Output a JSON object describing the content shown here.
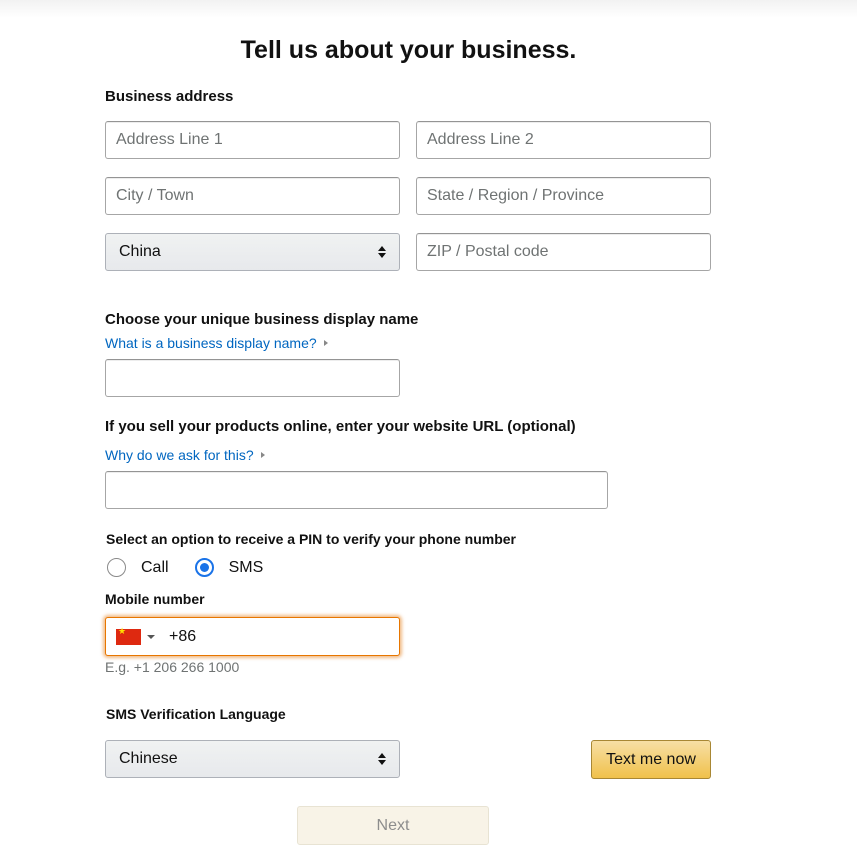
{
  "page": {
    "title": "Tell us about your business."
  },
  "address": {
    "section_label": "Business address",
    "line1_placeholder": "Address Line 1",
    "line2_placeholder": "Address Line 2",
    "city_placeholder": "City / Town",
    "state_placeholder": "State / Region / Province",
    "country_selected": "China",
    "zip_placeholder": "ZIP / Postal code"
  },
  "display_name": {
    "label": "Choose your unique business display name",
    "help_link": "What is a business display name?",
    "value": ""
  },
  "website": {
    "label": "If you sell your products online, enter your website URL (optional)",
    "help_link": "Why do we ask for this?",
    "value": ""
  },
  "verification": {
    "label": "Select an option to receive a PIN to verify your phone number",
    "options": [
      {
        "label": "Call",
        "checked": false
      },
      {
        "label": "SMS",
        "checked": true
      }
    ]
  },
  "mobile": {
    "label": "Mobile number",
    "country_flag_icon": "china-flag-icon",
    "dial_code": "+86",
    "example": "E.g. +1 206 266 1000"
  },
  "sms_language": {
    "label": "SMS Verification Language",
    "selected": "Chinese",
    "send_button": "Text me now"
  },
  "footer": {
    "next_button": "Next"
  },
  "colors": {
    "link": "#0066c0",
    "accent_yellow": "#f0c14b",
    "focus_orange": "#e77600",
    "radio_blue": "#1a73e8"
  }
}
